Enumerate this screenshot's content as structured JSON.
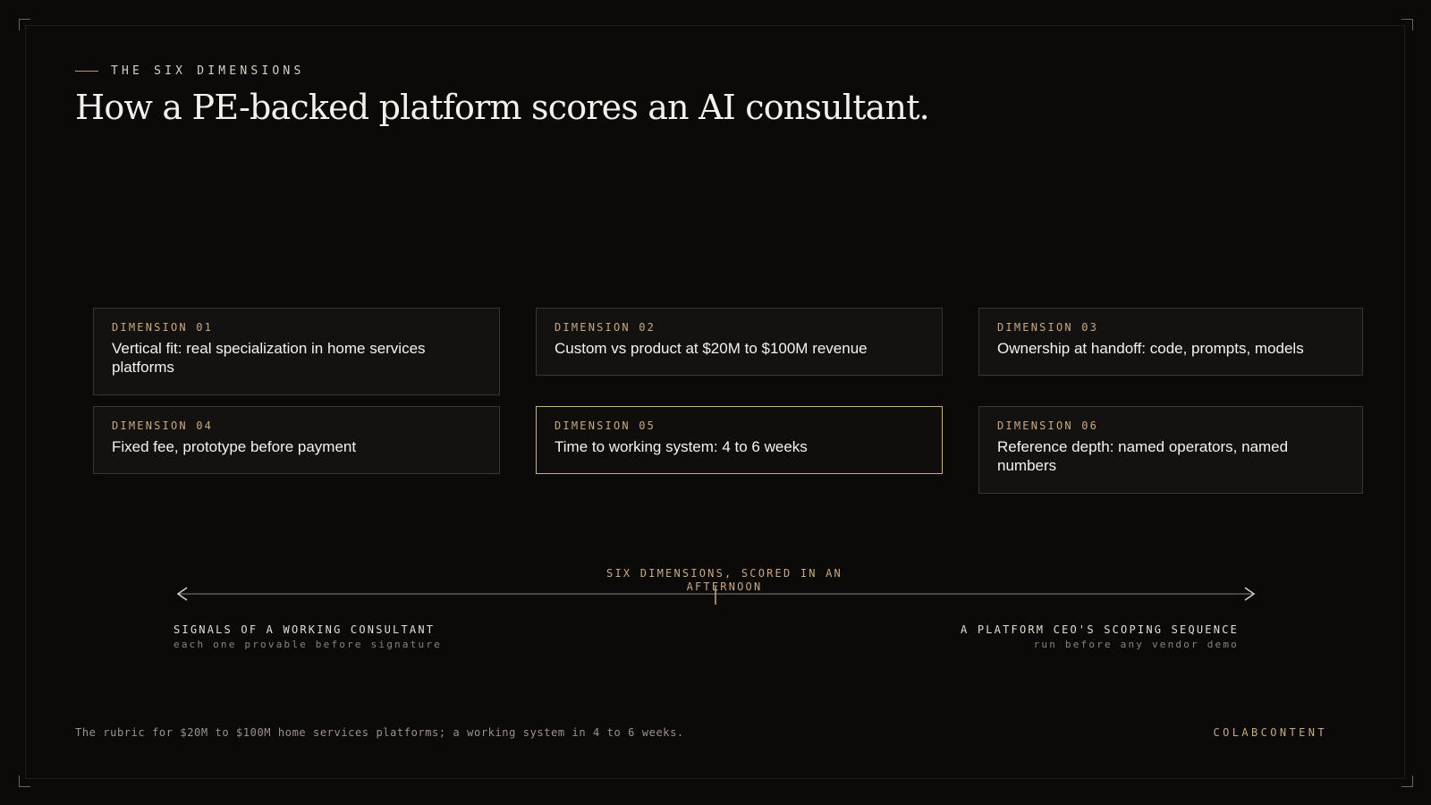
{
  "header": {
    "eyebrow": "THE SIX DIMENSIONS",
    "title": "How a PE-backed platform scores an AI consultant."
  },
  "dimensions": [
    {
      "label": "DIMENSION 01",
      "text": "Vertical fit: real specialization in home services platforms"
    },
    {
      "label": "DIMENSION 02",
      "text": "Custom vs product at $20M to $100M revenue"
    },
    {
      "label": "DIMENSION 03",
      "text": "Ownership at handoff: code, prompts, models"
    },
    {
      "label": "DIMENSION 04",
      "text": "Fixed fee, prototype before payment"
    },
    {
      "label": "DIMENSION 05",
      "text": "Time to working system: 4 to 6 weeks",
      "highlighted": true
    },
    {
      "label": "DIMENSION 06",
      "text": "Reference depth: named operators, named numbers"
    }
  ],
  "axis": {
    "center_label": "SIX DIMENSIONS, SCORED IN AN AFTERNOON",
    "left_title": "SIGNALS OF A WORKING CONSULTANT",
    "left_sub": "each one provable before signature",
    "right_title": "A PLATFORM CEO'S SCOPING SEQUENCE",
    "right_sub": "run before any vendor demo"
  },
  "footer": {
    "note": "The rubric for $20M to $100M home services platforms; a working system in 4 to 6 weeks.",
    "brand": "COLABCONTENT"
  },
  "colors": {
    "background": "#0b0a09",
    "accent": "#c7a882",
    "card": "#141210"
  }
}
